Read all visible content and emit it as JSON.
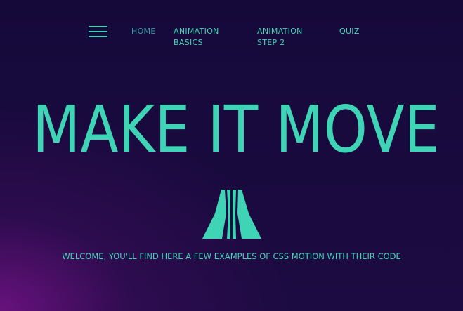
{
  "nav": {
    "menu_icon": "hamburger-menu-icon",
    "links": [
      {
        "lines": [
          "HOME"
        ]
      },
      {
        "lines": [
          "ANIMATION",
          "BASICS"
        ]
      },
      {
        "lines": [
          "ANIMATION",
          "STEP 2"
        ]
      },
      {
        "lines": [
          "QUIZ"
        ]
      }
    ]
  },
  "hero": {
    "title": "MAKE IT MOVE",
    "logo_icon": "abstract-road-logo-icon",
    "welcome": "WELCOME, YOU'LL FIND HERE A FEW EXAMPLES OF CSS MOTION WITH THEIR CODE"
  },
  "colors": {
    "accent": "#40d4b7",
    "accent_dim": "#3a9fa3",
    "background_top": "#15093a",
    "background_glow": "#6c1280"
  }
}
